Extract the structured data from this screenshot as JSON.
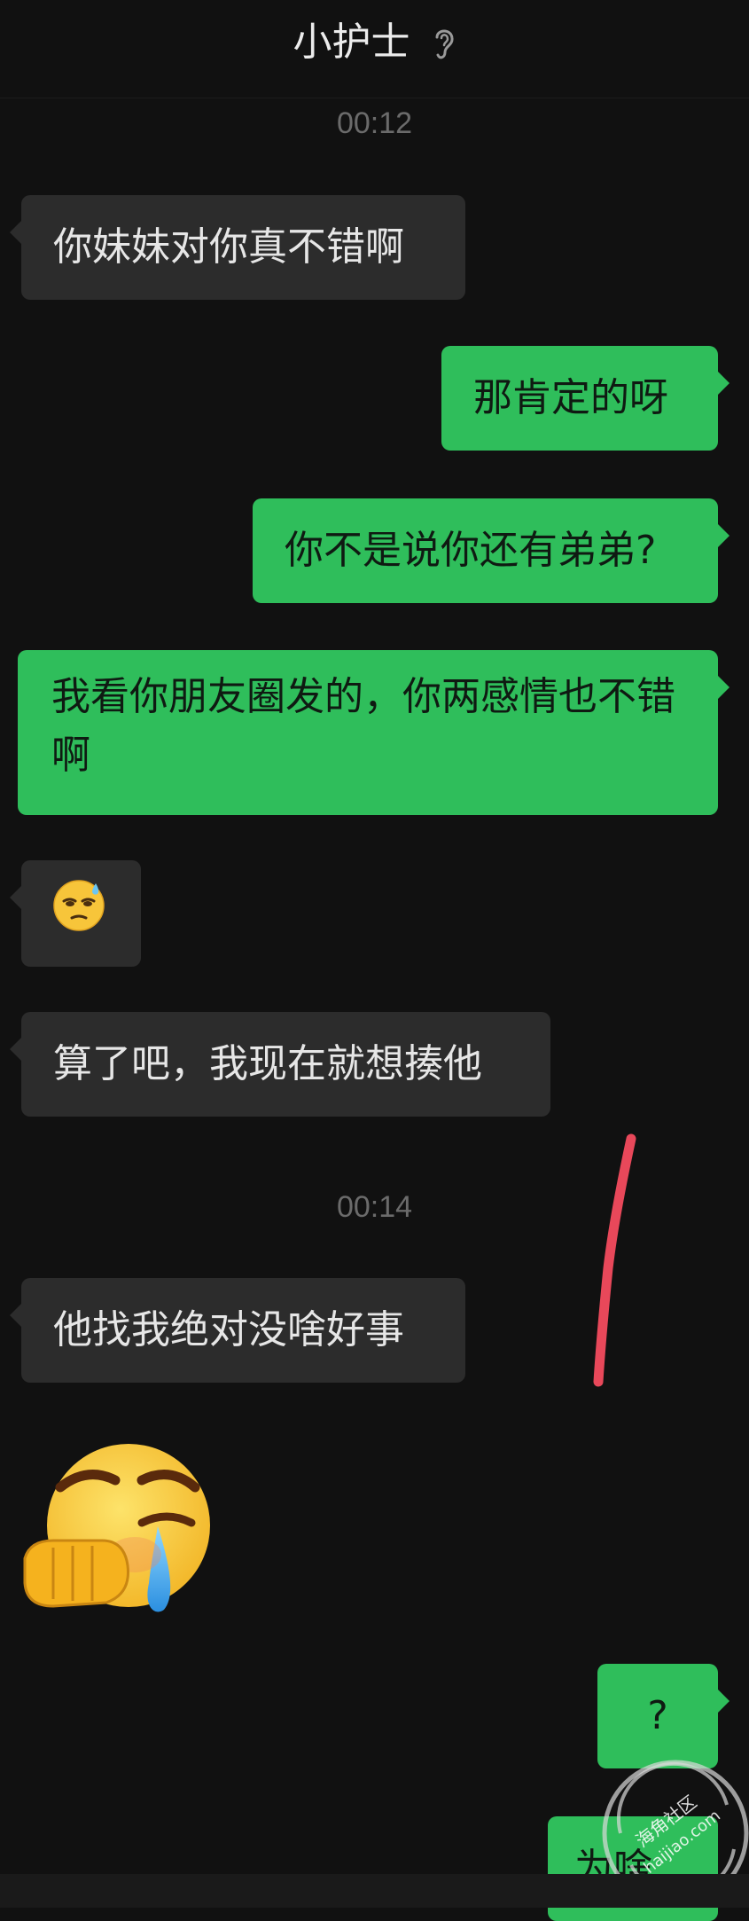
{
  "header": {
    "title": "小护士",
    "ear_icon": "ear-icon"
  },
  "timestamps": [
    "00:12",
    "00:14"
  ],
  "messages": [
    {
      "side": "left",
      "text": "你妹妹对你真不错啊"
    },
    {
      "side": "right",
      "text": "那肯定的呀"
    },
    {
      "side": "right",
      "text": "你不是说你还有弟弟?"
    },
    {
      "side": "right",
      "text": "我看你朋友圈发的，你两感情也不错啊"
    },
    {
      "side": "left",
      "emoji": "sweat-smile-emoji"
    },
    {
      "side": "left",
      "text": "算了吧，我现在就想揍他"
    },
    {
      "side": "left",
      "text": "他找我绝对没啥好事"
    },
    {
      "side": "left",
      "sticker": "crying-fist-sticker"
    },
    {
      "side": "right",
      "text": "?"
    },
    {
      "side": "right",
      "text": "为啥"
    }
  ],
  "watermark": {
    "line1": "海角社区",
    "line2": "haijiao.com"
  },
  "colors": {
    "background": "#111111",
    "bubble_left": "#2c2c2c",
    "bubble_right": "#2fbe5b",
    "annotation": "#e8485a"
  }
}
